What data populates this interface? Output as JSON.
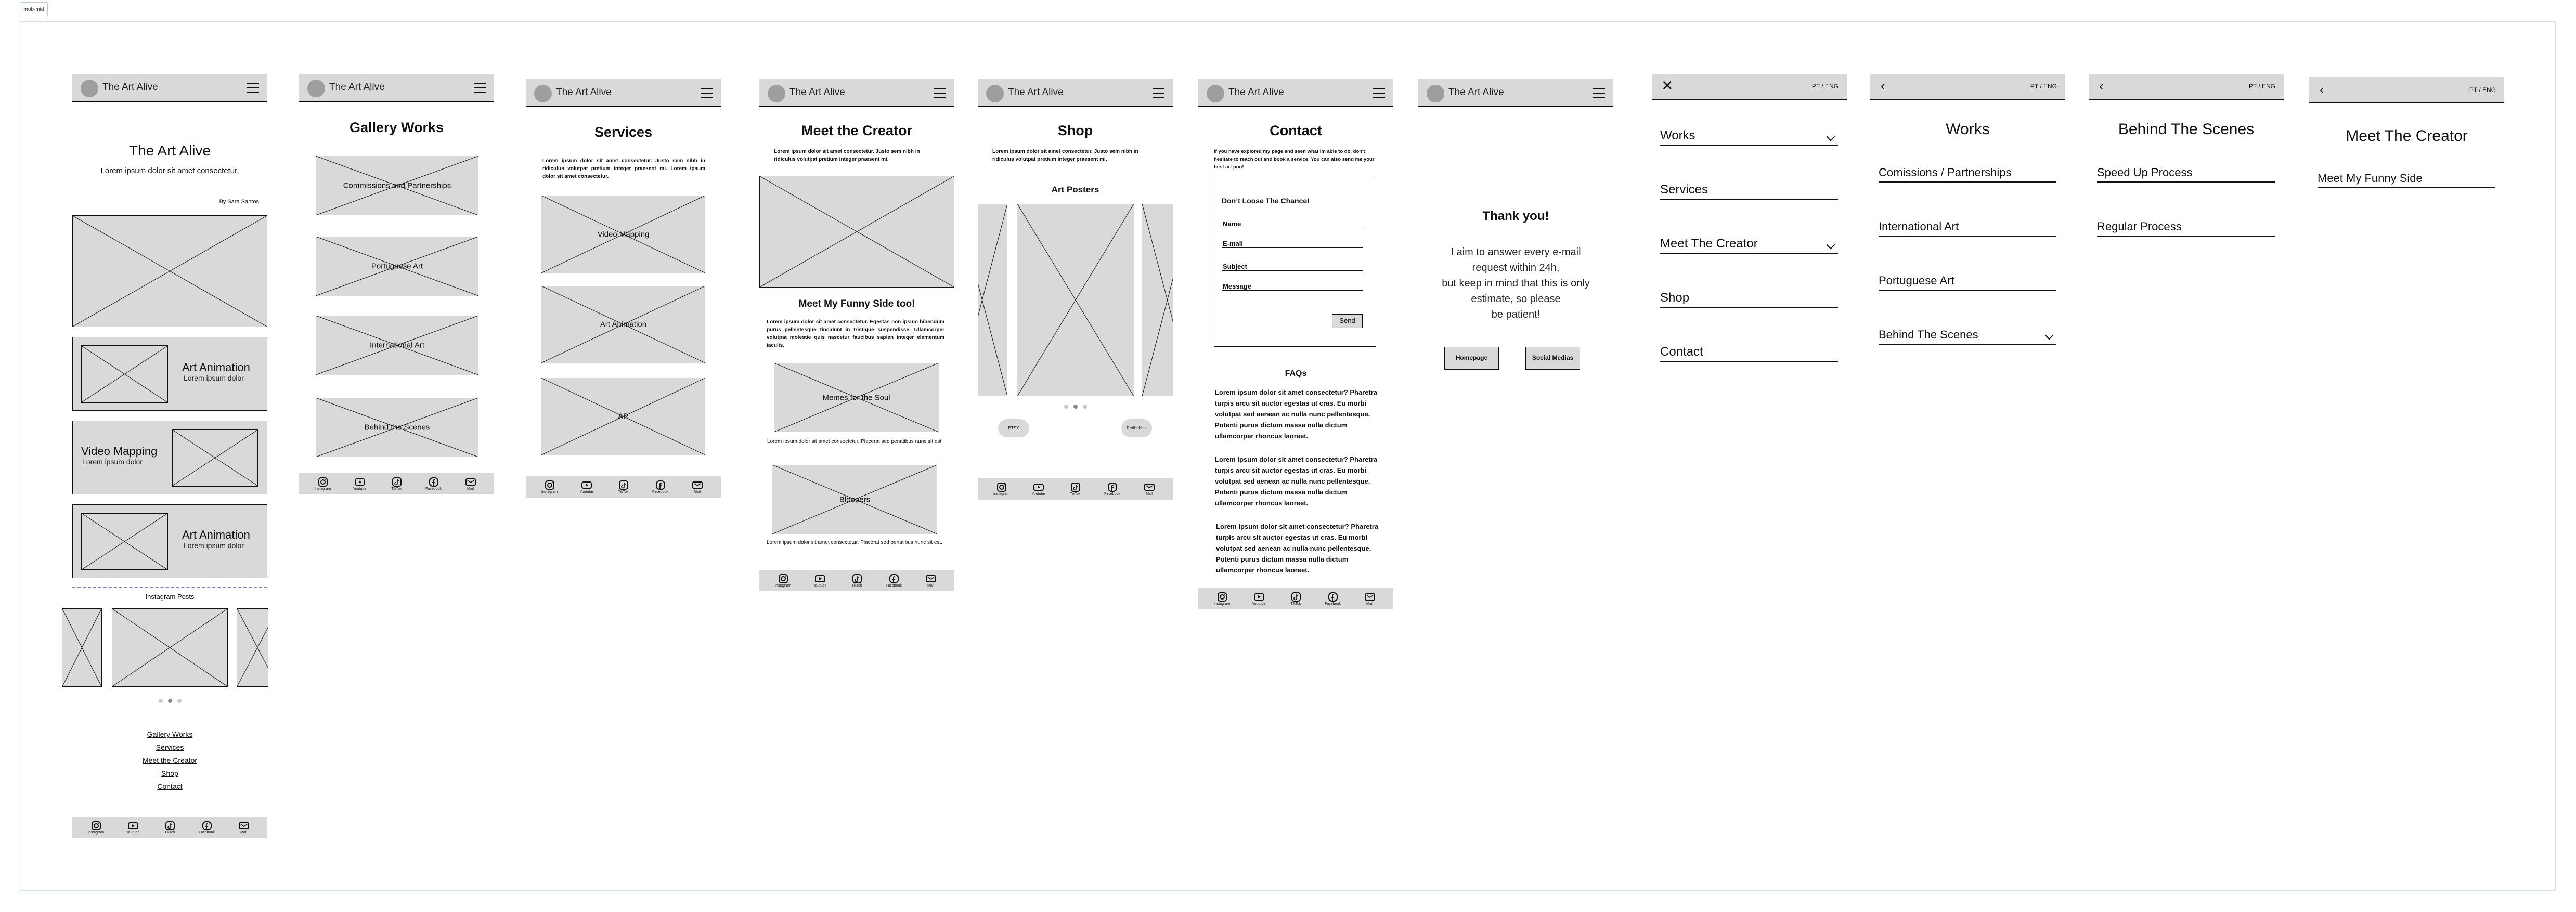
{
  "canvas_label": "mob-mid",
  "header": {
    "brand": "The Art Alive"
  },
  "footer_icons": [
    {
      "icon": "instagram-icon",
      "label": "Instagram"
    },
    {
      "icon": "youtube-icon",
      "label": "Youtube"
    },
    {
      "icon": "tiktok-icon",
      "label": "TikTok"
    },
    {
      "icon": "facebook-icon",
      "label": "Facebook"
    },
    {
      "icon": "mail-icon",
      "label": "Mail"
    }
  ],
  "home": {
    "title": "The Art Alive",
    "subtitle": "Lorem ipsum dolor sit amet consectetur.",
    "byline": "By Sara Santos",
    "cards": [
      {
        "title": "Art Animation",
        "sub": "Lorem ipsum dolor"
      },
      {
        "title": "Video Mapping",
        "sub": "Lorem ipsum dolor"
      },
      {
        "title": "Art Animation",
        "sub": "Lorem ipsum dolor"
      }
    ],
    "instagram_title": "Instagram Posts",
    "carousel_active": 2,
    "links": [
      "Gallery Works",
      "Services",
      "Meet the Creator",
      "Shop",
      "Contact"
    ]
  },
  "gallery": {
    "title": "Gallery Works",
    "tiles": [
      "Commissions and Partnerships",
      "Portuguese Art",
      "International Art",
      "Behind the Scenes"
    ]
  },
  "services": {
    "title": "Services",
    "text": "Lorem ipsum dolor sit amet consectetur. Justo sem nibh in ridiculus volutpat pretium integer praesent mi. Lorem ipsum dolor sit amet consectetur.",
    "tiles": [
      "Video Mapping",
      "Art Animation",
      "AR"
    ]
  },
  "creator": {
    "title": "Meet the Creator",
    "text": "Lorem ipsum dolor sit amet consectetur. Justo sem nibh in ridiculus volutpat pretium integer praesent mi.",
    "subtitle": "Meet My Funny Side too!",
    "text2": "Lorem ipsum dolor sit amet consectetur. Egestas non ipsum bibendum purus pellentesque tincidunt in tristique suspendisse. Ullamcorper volutpat molestie quis nascetur faucibus sapien integer elementum iaculis.",
    "tiles": [
      {
        "label": "Memes for the Soul",
        "caption": "Lorem ipsum dolor sit amet consectetur. Placerat sed penatibus nunc sit est."
      },
      {
        "label": "Bloopers",
        "caption": "Lorem ipsum dolor sit amet consectetur. Placerat sed penatibus nunc sit est."
      }
    ]
  },
  "shop": {
    "title": "Shop",
    "text": "Lorem ipsum dolor sit amet consectetur. Justo sem nibh in ridiculus volutpat pretium integer praesent mi.",
    "section": "Art Posters",
    "carousel_active": 2,
    "buttons": [
      "ETSY",
      "Redbubble"
    ]
  },
  "contact": {
    "title": "Contact",
    "text": "If you have explored my page and seen what im able to do, don't hesitate to reach out and book a service. You can also send me your best art pun!",
    "form_title": "Don’t Loose The Chance!",
    "fields": [
      "Name",
      "E-mail",
      "Subject",
      "Message"
    ],
    "send": "Send",
    "faq_title": "FAQs",
    "faqs": [
      "Lorem ipsum dolor sit amet consectetur? Pharetra turpis arcu sit auctor egestas ut cras. Eu morbi volutpat sed aenean ac nulla nunc pellentesque. Potenti purus dictum massa nulla dictum ullamcorper rhoncus laoreet.",
      "Lorem ipsum dolor sit amet consectetur? Pharetra turpis arcu sit auctor egestas ut cras. Eu morbi volutpat sed aenean ac nulla nunc pellentesque. Potenti purus dictum massa nulla dictum ullamcorper rhoncus laoreet.",
      "Lorem ipsum dolor sit amet consectetur? Pharetra turpis arcu sit auctor egestas ut cras. Eu morbi volutpat sed aenean ac nulla nunc pellentesque. Potenti purus dictum massa nulla dictum ullamcorper rhoncus laoreet."
    ]
  },
  "thanks": {
    "title": "Thank you!",
    "lines": [
      "I aim to answer every e-mail",
      "request within 24h,",
      "but keep in mind that this is only",
      "estimate, so please",
      "be patient!"
    ],
    "buttons": [
      "Homepage",
      "Social Medias"
    ]
  },
  "lang": "PT / ENG",
  "menu": {
    "items": [
      {
        "label": "Works",
        "chevron": true
      },
      {
        "label": "Services",
        "chevron": false
      },
      {
        "label": "Meet The Creator",
        "chevron": true
      },
      {
        "label": "Shop",
        "chevron": false
      },
      {
        "label": "Contact",
        "chevron": false
      }
    ]
  },
  "works_menu": {
    "title": "Works",
    "items": [
      "Comissions / Partnerships",
      "International Art",
      "Portuguese Art",
      "Behind The Scenes"
    ]
  },
  "bts_menu": {
    "title": "Behind The Scenes",
    "items": [
      "Speed Up Process",
      "Regular Process"
    ]
  },
  "creator_menu": {
    "title": "Meet The Creator",
    "items": [
      "Meet My Funny Side"
    ]
  }
}
